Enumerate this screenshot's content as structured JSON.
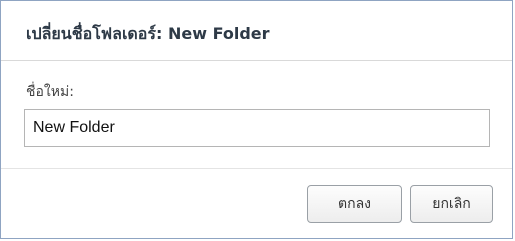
{
  "dialog": {
    "title": "เปลี่ยนชื่อโฟลเดอร์: New Folder",
    "field_label": "ชื่อใหม่:",
    "input_value": "New Folder",
    "ok_label": "ตกลง",
    "cancel_label": "ยกเลิก"
  },
  "colors": {
    "border": "#8fa4c2",
    "title_text": "#2e3a47"
  }
}
